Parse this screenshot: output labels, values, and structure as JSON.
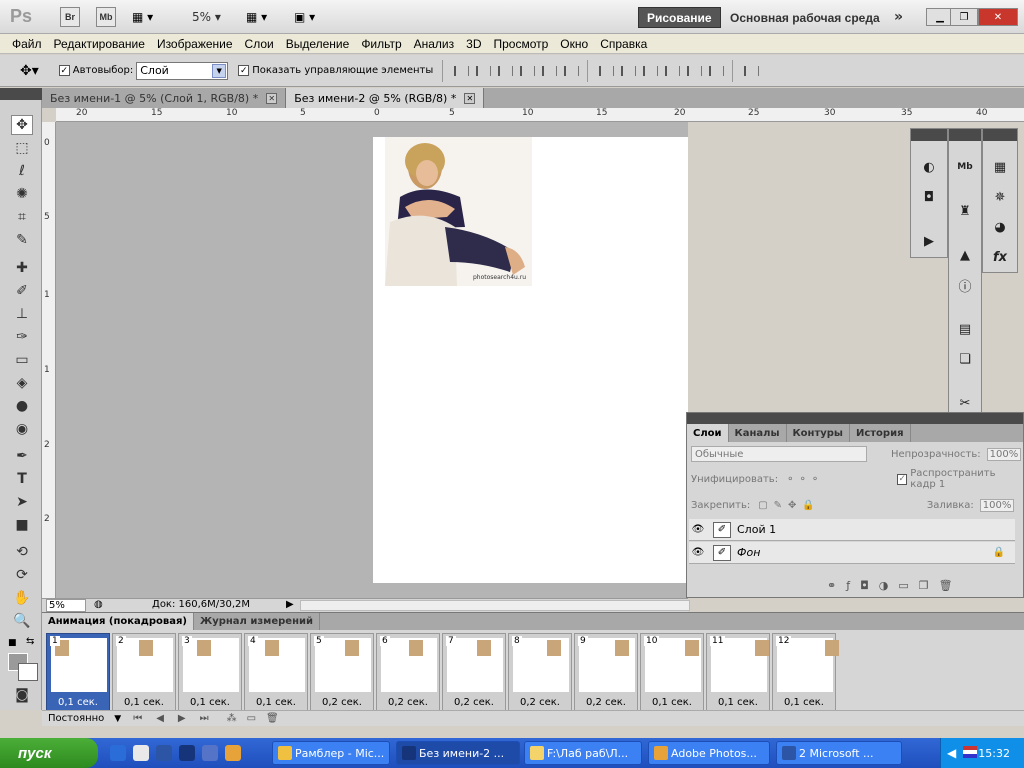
{
  "app": {
    "logo": "Ps",
    "bridge": "Br",
    "minibridge": "Mb",
    "zoom": "5%",
    "workspace_active": "Рисование",
    "workspace_main": "Основная рабочая среда"
  },
  "menu": [
    "Файл",
    "Редактирование",
    "Изображение",
    "Слои",
    "Выделение",
    "Фильтр",
    "Анализ",
    "3D",
    "Просмотр",
    "Окно",
    "Справка"
  ],
  "options": {
    "autoselect_label": "Автовыбор:",
    "autoselect_value": "Слой",
    "show_controls_label": "Показать управляющие элементы"
  },
  "doc_tabs": [
    {
      "label": "Без имени-1 @ 5% (Слой 1, RGB/8) *"
    },
    {
      "label": "Без имени-2 @ 5% (RGB/8) *"
    }
  ],
  "ruler_h": [
    "20",
    "15",
    "10",
    "5",
    "0",
    "5",
    "10",
    "15",
    "20",
    "25",
    "30",
    "35",
    "40"
  ],
  "ruler_v": [
    "0",
    "5",
    "1",
    "1",
    "2",
    "2"
  ],
  "photo_caption": "photosearch4u.ru",
  "status": {
    "zoom": "5%",
    "doc": "Док: 160,6M/30,2M"
  },
  "layers_panel": {
    "tabs": [
      "Слои",
      "Каналы",
      "Контуры",
      "История"
    ],
    "blend_mode": "Обычные",
    "opacity_label": "Непрозрачность:",
    "opacity_value": "100%",
    "unify_label": "Унифицировать:",
    "propagate_label": "Распространить кадр 1",
    "lock_label": "Закрепить:",
    "fill_label": "Заливка:",
    "fill_value": "100%",
    "layers": [
      {
        "name": "Слой 1"
      },
      {
        "name": "Фон"
      }
    ]
  },
  "animation": {
    "tabs": [
      "Анимация (покадровая)",
      "Журнал измерений"
    ],
    "frames": [
      {
        "num": "1",
        "delay": "0,1 сек."
      },
      {
        "num": "2",
        "delay": "0,1 сек."
      },
      {
        "num": "3",
        "delay": "0,1 сек."
      },
      {
        "num": "4",
        "delay": "0,1 сек."
      },
      {
        "num": "5",
        "delay": "0,2 сек."
      },
      {
        "num": "6",
        "delay": "0,2 сек."
      },
      {
        "num": "7",
        "delay": "0,2 сек."
      },
      {
        "num": "8",
        "delay": "0,2 сек."
      },
      {
        "num": "9",
        "delay": "0,2 сек."
      },
      {
        "num": "10",
        "delay": "0,1 сек."
      },
      {
        "num": "11",
        "delay": "0,1 сек."
      },
      {
        "num": "12",
        "delay": "0,1 сек."
      }
    ],
    "loop": "Постоянно"
  },
  "taskbar": {
    "start": "пуск",
    "tasks": [
      {
        "label": "Рамблер - Mic..."
      },
      {
        "label": "Без имени-2 ..."
      },
      {
        "label": "F:\\Лаб раб\\Л..."
      },
      {
        "label": "Adobe Photos..."
      },
      {
        "label": "2 Microsoft ..."
      }
    ],
    "time": "15:32"
  },
  "colors": {
    "workspace_active_bg": "#555555",
    "taskbar": "#2458d0",
    "start": "#3a9b2a",
    "selected_frame": "#3a65b7"
  }
}
